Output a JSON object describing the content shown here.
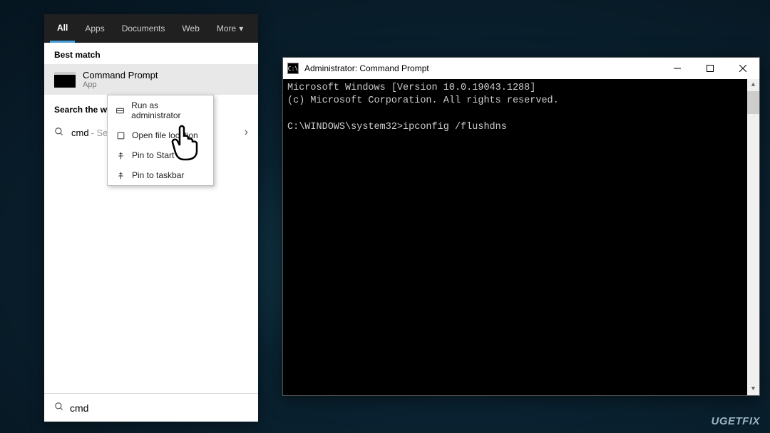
{
  "search": {
    "tabs": {
      "all": "All",
      "apps": "Apps",
      "documents": "Documents",
      "web": "Web",
      "more": "More"
    },
    "best_match_label": "Best match",
    "result": {
      "title": "Command Prompt",
      "subtitle": "App"
    },
    "search_web_label": "Search the web",
    "web_item": {
      "query": "cmd",
      "suffix": " - See"
    },
    "input_value": "cmd"
  },
  "context_menu": {
    "run_admin": "Run as administrator",
    "open_location": "Open file location",
    "pin_start": "Pin to Start",
    "pin_taskbar": "Pin to taskbar"
  },
  "cmd": {
    "title": "Administrator: Command Prompt",
    "line1": "Microsoft Windows [Version 10.0.19043.1288]",
    "line2": "(c) Microsoft Corporation. All rights reserved.",
    "prompt_path": "C:\\WINDOWS\\system32>",
    "command": "ipconfig /flushdns"
  },
  "watermark": "UGETFIX"
}
